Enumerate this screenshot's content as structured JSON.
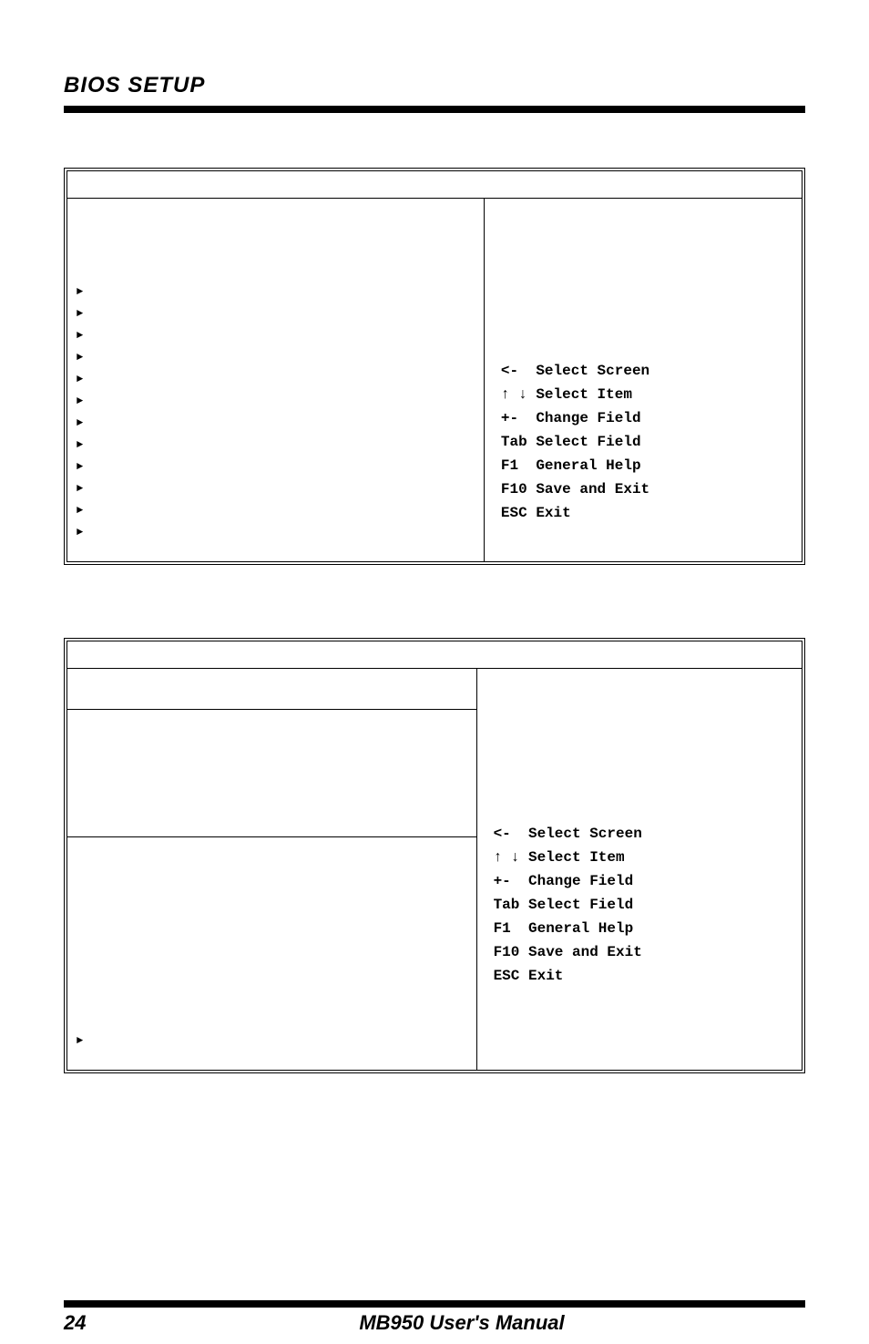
{
  "header": {
    "title": "BIOS SETUP"
  },
  "box1": {
    "help": {
      "l1": "<-  Select Screen",
      "l2": "↑ ↓ Select Item",
      "l3": "+-  Change Field",
      "l4": "Tab Select Field",
      "l5": "F1  General Help",
      "l6": "F10 Save and Exit",
      "l7": "ESC Exit"
    }
  },
  "box2": {
    "help": {
      "l1": "<-  Select Screen",
      "l2": "↑ ↓ Select Item",
      "l3": "+-  Change Field",
      "l4": "Tab Select Field",
      "l5": "F1  General Help",
      "l6": "F10 Save and Exit",
      "l7": "ESC Exit"
    }
  },
  "footer": {
    "page": "24",
    "manual": "MB950 User's Manual"
  },
  "icons": {
    "triangle": "►"
  }
}
